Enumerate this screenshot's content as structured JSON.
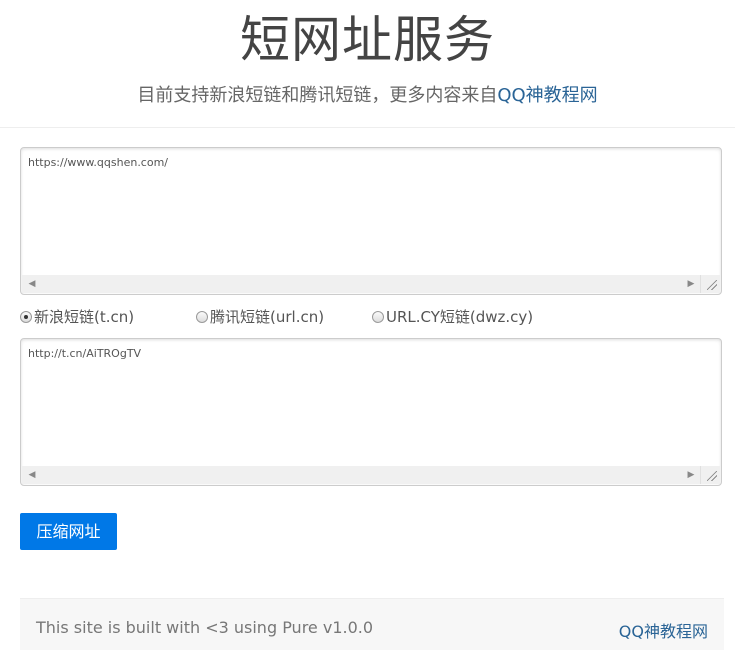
{
  "header": {
    "title": "短网址服务",
    "subtitle_prefix": "目前支持新浪短链和腾讯短链，更多内容来自",
    "subtitle_link": "QQ神教程网"
  },
  "input_url": "https://www.qqshen.com/",
  "options": [
    {
      "label": "新浪短链(t.cn)",
      "checked": true
    },
    {
      "label": "腾讯短链(url.cn)",
      "checked": false
    },
    {
      "label": "URL.CY短链(dwz.cy)",
      "checked": false
    }
  ],
  "output_url": "http://t.cn/AiTROgTV",
  "button_label": "压缩网址",
  "footer": {
    "left": "This site is built with <3 using Pure v1.0.0",
    "right": "QQ神教程网"
  },
  "colors": {
    "button": "#0078e7",
    "link": "#2a6496"
  }
}
